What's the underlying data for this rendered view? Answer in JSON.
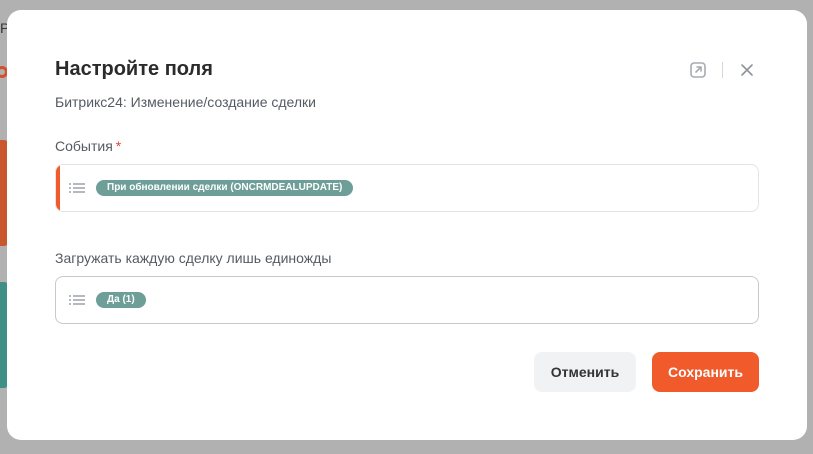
{
  "background": {
    "letter": "P"
  },
  "modal": {
    "title": "Настройте поля",
    "subtitle": "Битрикс24: Изменение/создание сделки",
    "icons": {
      "open_external": "open-external-icon",
      "close": "close-icon"
    }
  },
  "fields": {
    "events": {
      "label": "События",
      "required_mark": "*",
      "chip": "При обновлении сделки (ONCRMDEALUPDATE)"
    },
    "load_once": {
      "label": "Загружать каждую сделку лишь единожды",
      "chip": "Да (1)"
    }
  },
  "buttons": {
    "cancel": "Отменить",
    "save": "Сохранить"
  },
  "colors": {
    "accent": "#f15a2b",
    "chip": "#6e9e98",
    "required": "#e4482b"
  }
}
